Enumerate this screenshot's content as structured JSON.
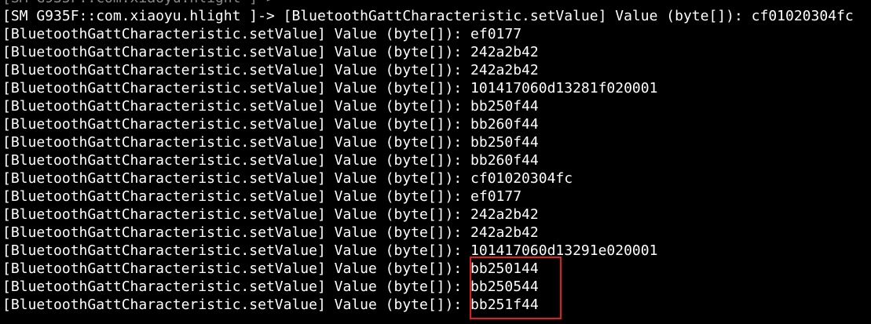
{
  "terminal": {
    "lines": [
      "[SM G935F::com.xiaoyu.hlight ]->",
      "[SM G935F::com.xiaoyu.hlight ]-> [BluetoothGattCharacteristic.setValue] Value (byte[]): cf01020304fc",
      "[BluetoothGattCharacteristic.setValue] Value (byte[]): ef0177",
      "[BluetoothGattCharacteristic.setValue] Value (byte[]): 242a2b42",
      "[BluetoothGattCharacteristic.setValue] Value (byte[]): 242a2b42",
      "[BluetoothGattCharacteristic.setValue] Value (byte[]): 101417060d13281f020001",
      "[BluetoothGattCharacteristic.setValue] Value (byte[]): bb250f44",
      "[BluetoothGattCharacteristic.setValue] Value (byte[]): bb260f44",
      "[BluetoothGattCharacteristic.setValue] Value (byte[]): bb250f44",
      "[BluetoothGattCharacteristic.setValue] Value (byte[]): bb260f44",
      "[BluetoothGattCharacteristic.setValue] Value (byte[]): cf01020304fc",
      "[BluetoothGattCharacteristic.setValue] Value (byte[]): ef0177",
      "[BluetoothGattCharacteristic.setValue] Value (byte[]): 242a2b42",
      "[BluetoothGattCharacteristic.setValue] Value (byte[]): 242a2b42",
      "[BluetoothGattCharacteristic.setValue] Value (byte[]): 101417060d13291e020001",
      "[BluetoothGattCharacteristic.setValue] Value (byte[]): bb250144",
      "[BluetoothGattCharacteristic.setValue] Value (byte[]): bb250544",
      "[BluetoothGattCharacteristic.setValue] Value (byte[]): bb251f44"
    ]
  },
  "colors": {
    "background": "#000000",
    "text": "#ffffff",
    "dim_text": "#8a8a8a",
    "highlight": "#e01e1e"
  }
}
